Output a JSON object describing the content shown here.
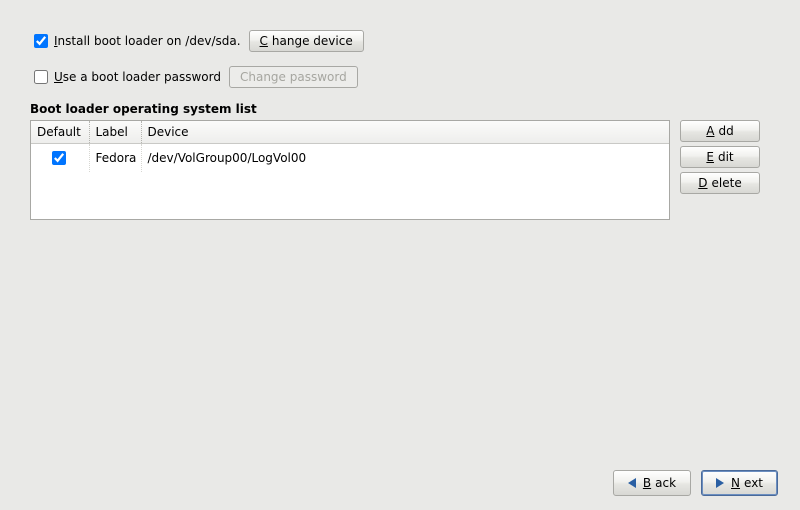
{
  "options": {
    "install_bootloader": {
      "checked": true,
      "label_pre": "",
      "label_mn": "I",
      "label_post": "nstall boot loader on /dev/sda.",
      "change_btn_mn": "C",
      "change_btn_post": "hange device"
    },
    "use_password": {
      "checked": false,
      "label_mn": "U",
      "label_post": "se a boot loader password",
      "change_pw_btn": "Change password"
    }
  },
  "os_list": {
    "title": "Boot loader operating system list",
    "columns": {
      "default": "Default",
      "label": "Label",
      "device": "Device"
    },
    "rows": [
      {
        "default": true,
        "label": "Fedora",
        "device": "/dev/VolGroup00/LogVol00"
      }
    ]
  },
  "side_buttons": {
    "add_mn": "A",
    "add_post": "dd",
    "edit_mn": "E",
    "edit_post": "dit",
    "delete_mn": "D",
    "delete_post": "elete"
  },
  "footer": {
    "back_mn": "B",
    "back_post": "ack",
    "next_mn": "N",
    "next_post": "ext"
  }
}
